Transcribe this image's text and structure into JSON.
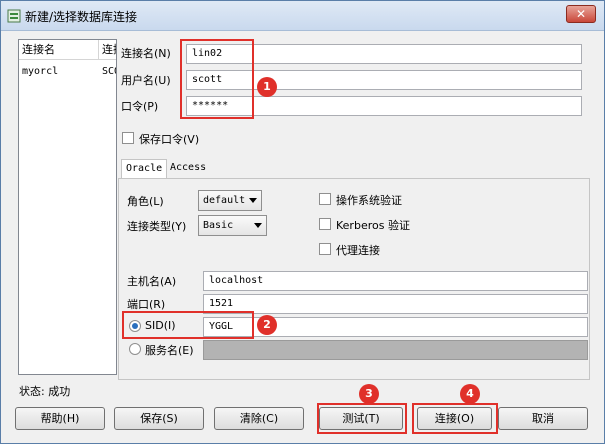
{
  "window": {
    "title": "新建/选择数据库连接"
  },
  "conn_list": {
    "headers": [
      "连接名",
      "连接"
    ],
    "rows": [
      [
        "myorcl",
        "SCOTT"
      ]
    ]
  },
  "form": {
    "conn_name_label": "连接名(N)",
    "conn_name_value": "lin02",
    "user_label": "用户名(U)",
    "user_value": "scott",
    "pwd_label": "口令(P)",
    "pwd_value": "******",
    "save_pwd_label": "保存口令(V)",
    "save_pwd_checked": false
  },
  "tabs": [
    {
      "label": "Oracle",
      "active": true
    },
    {
      "label": "Access",
      "active": false
    }
  ],
  "oracle": {
    "role_label": "角色(L)",
    "role_value": "default",
    "conn_type_label": "连接类型(Y)",
    "conn_type_value": "Basic",
    "os_auth_label": "操作系统验证",
    "kerberos_label": "Kerberos 验证",
    "proxy_label": "代理连接",
    "host_label": "主机名(A)",
    "host_value": "localhost",
    "port_label": "端口(R)",
    "port_value": "1521",
    "sid_label": "SID(I)",
    "sid_value": "YGGL",
    "sid_selected": true,
    "service_label": "服务名(E)",
    "service_value": ""
  },
  "status": {
    "text": "状态: 成功"
  },
  "buttons": {
    "help": "帮助(H)",
    "save": "保存(S)",
    "clear": "清除(C)",
    "test": "测试(T)",
    "connect": "连接(O)",
    "cancel": "取消"
  },
  "annotations": [
    "1",
    "2",
    "3",
    "4"
  ],
  "colors": {
    "annotation_red": "#e0302a",
    "title_bar": "#c9d9ee",
    "window_bg": "#f0f0f0"
  }
}
